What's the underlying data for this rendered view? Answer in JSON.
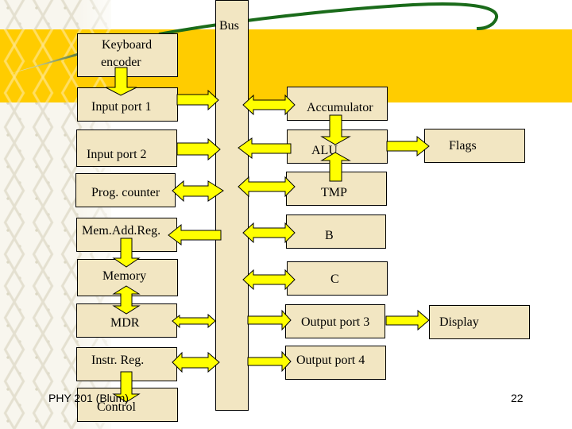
{
  "slide": {
    "footer_left": "PHY 201 (Blum)",
    "page_number": "22"
  },
  "colors": {
    "box_fill": "#f2e6c2",
    "arrow_fill": "#ffff00",
    "band": "#ffcc00",
    "swoosh": "#1a6b1a"
  },
  "bus": {
    "label": "Bus"
  },
  "left_column": {
    "keyboard_encoder": {
      "line1": "Keyboard",
      "line2": "encoder"
    },
    "input_port_1": "Input port 1",
    "input_port_2": "Input port 2",
    "prog_counter": "Prog. counter",
    "mem_add_reg": "Mem.Add.Reg.",
    "memory": "Memory",
    "mdr": "MDR",
    "instr_reg": "Instr. Reg.",
    "control": "Control"
  },
  "right_column": {
    "accumulator": "Accumulator",
    "alu": "ALU",
    "tmp": "TMP",
    "b": "B",
    "c": "C",
    "output_port_3": "Output port 3",
    "output_port_4": "Output port 4"
  },
  "far_right": {
    "flags": "Flags",
    "display": "Display"
  },
  "connections": [
    {
      "from": "Keyboard encoder",
      "to": "Input port 1",
      "direction": "down"
    },
    {
      "from": "Input port 1",
      "to": "Bus",
      "direction": "one-way"
    },
    {
      "from": "Input port 2",
      "to": "Bus",
      "direction": "one-way"
    },
    {
      "from": "Prog. counter",
      "to": "Bus",
      "direction": "two-way"
    },
    {
      "from": "Bus",
      "to": "Mem.Add.Reg.",
      "direction": "one-way"
    },
    {
      "from": "Mem.Add.Reg.",
      "to": "Memory",
      "direction": "down"
    },
    {
      "from": "Memory",
      "to": "MDR",
      "direction": "two-way"
    },
    {
      "from": "MDR",
      "to": "Bus",
      "direction": "two-way"
    },
    {
      "from": "Instr. Reg.",
      "to": "Bus",
      "direction": "two-way"
    },
    {
      "from": "Instr. Reg.",
      "to": "Control",
      "direction": "down"
    },
    {
      "from": "Bus",
      "to": "Accumulator",
      "direction": "two-way"
    },
    {
      "from": "Bus",
      "to": "ALU",
      "direction": "one-way-to-bus"
    },
    {
      "from": "Bus",
      "to": "TMP",
      "direction": "two-way"
    },
    {
      "from": "Bus",
      "to": "B",
      "direction": "two-way"
    },
    {
      "from": "Bus",
      "to": "C",
      "direction": "two-way"
    },
    {
      "from": "Bus",
      "to": "Output port 3",
      "direction": "one-way"
    },
    {
      "from": "Bus",
      "to": "Output port 4",
      "direction": "one-way"
    },
    {
      "from": "Accumulator",
      "to": "ALU",
      "direction": "down"
    },
    {
      "from": "TMP",
      "to": "ALU",
      "direction": "up"
    },
    {
      "from": "ALU",
      "to": "Flags",
      "direction": "one-way"
    },
    {
      "from": "Output port 3",
      "to": "Display",
      "direction": "one-way"
    }
  ]
}
